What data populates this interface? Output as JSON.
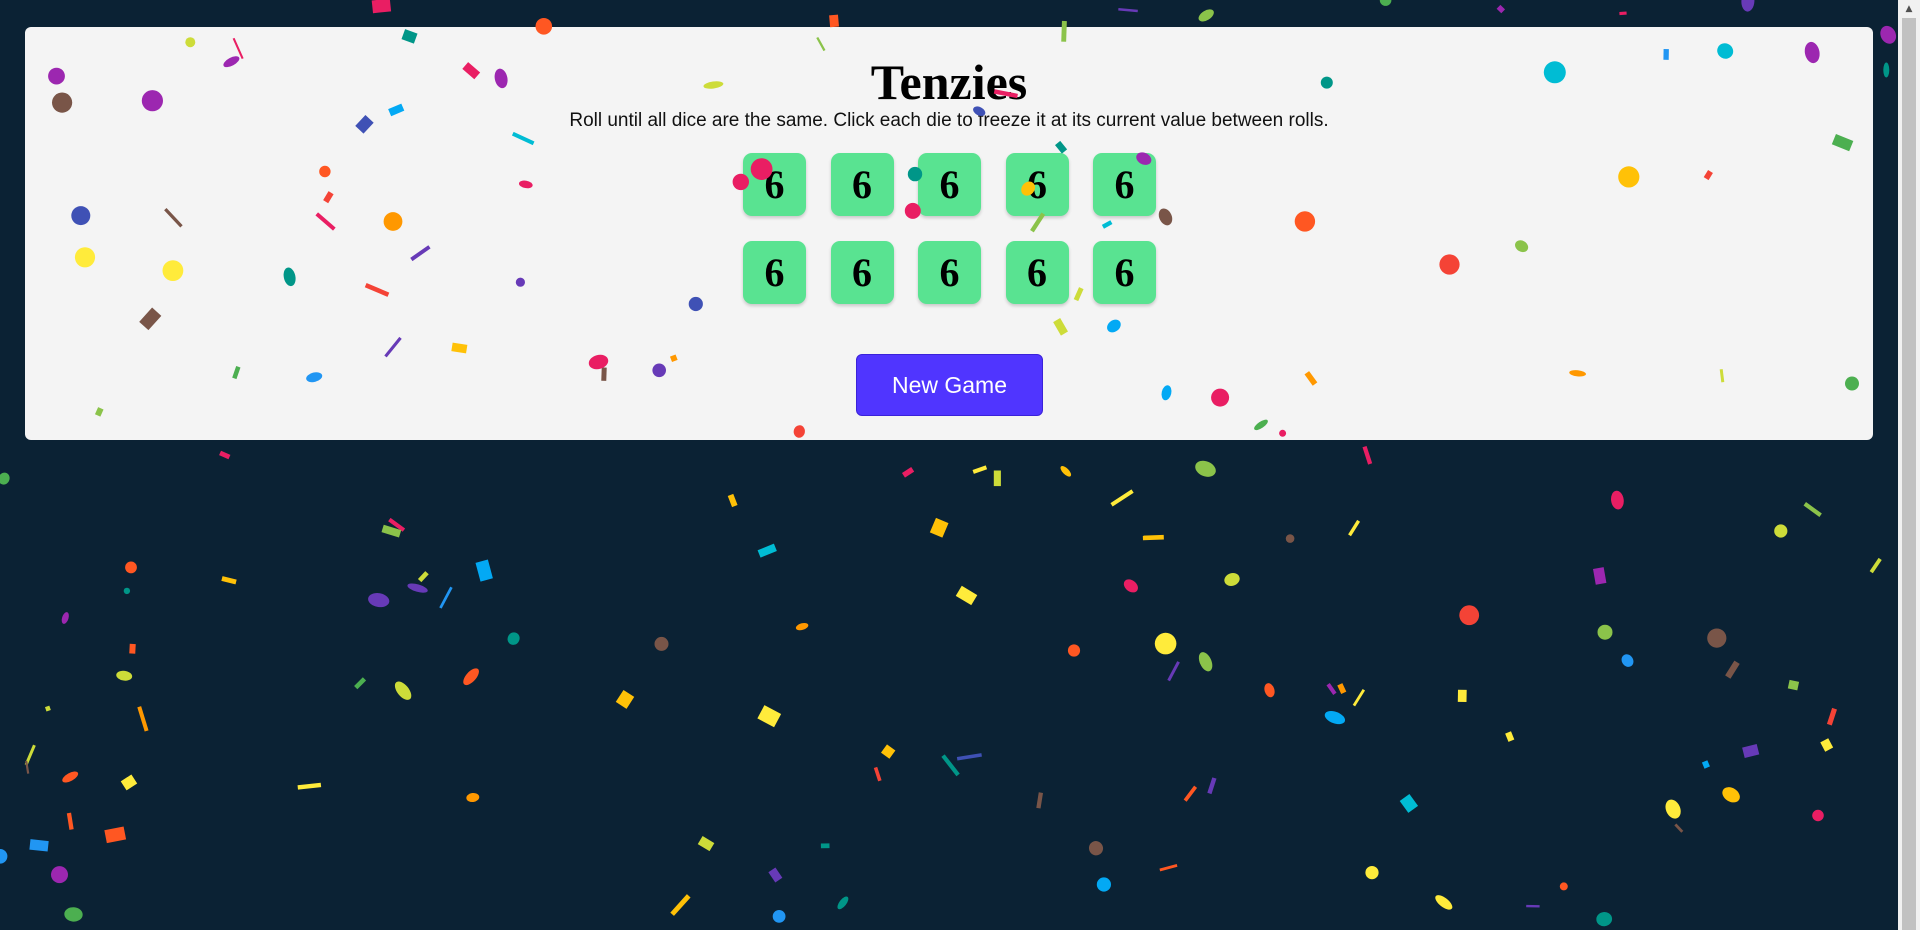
{
  "app": {
    "title": "Tenzies",
    "instructions": "Roll until all dice are the same. Click each die to freeze it at its current value between rolls."
  },
  "dice": [
    {
      "value": "6",
      "held": false
    },
    {
      "value": "6",
      "held": false
    },
    {
      "value": "6",
      "held": false
    },
    {
      "value": "6",
      "held": false
    },
    {
      "value": "6",
      "held": false
    },
    {
      "value": "6",
      "held": false
    },
    {
      "value": "6",
      "held": false
    },
    {
      "value": "6",
      "held": false
    },
    {
      "value": "6",
      "held": false
    },
    {
      "value": "6",
      "held": false
    }
  ],
  "controls": {
    "new_game_label": "New Game"
  },
  "game_state": {
    "won": true,
    "confetti": true
  },
  "colors": {
    "background": "#0b2234",
    "card": "#f4f4f4",
    "die": "#59e391",
    "button": "#5035ff",
    "confetti_palette": [
      "#e91e63",
      "#9c27b0",
      "#673ab7",
      "#3f51b5",
      "#2196f3",
      "#03a9f4",
      "#00bcd4",
      "#009688",
      "#4caf50",
      "#8bc34a",
      "#cddc39",
      "#ffeb3b",
      "#ffc107",
      "#ff9800",
      "#ff5722",
      "#795548",
      "#f44336"
    ]
  },
  "icons": {
    "scroll_up": "scroll-up-arrow-icon"
  }
}
